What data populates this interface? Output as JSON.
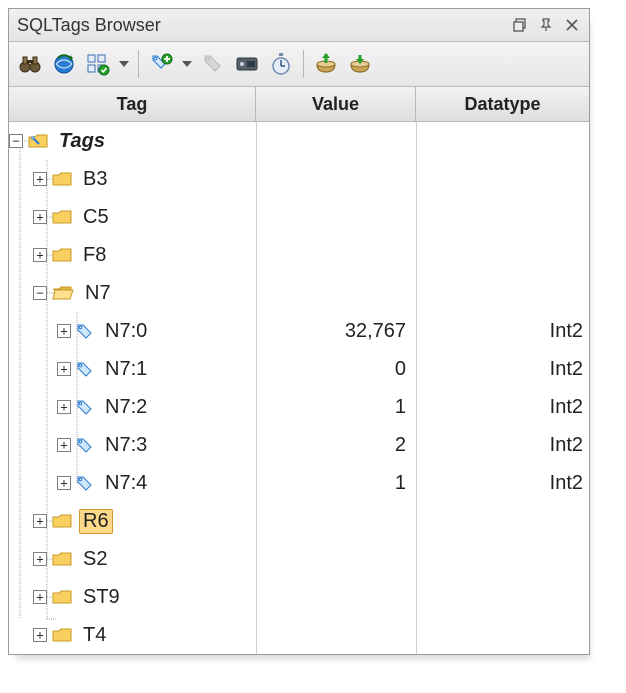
{
  "title": "SQLTags Browser",
  "toolbar": {
    "binoculars": "find-icon",
    "refresh": "refresh-icon",
    "multiselect": "multi-edit-icon",
    "newitem": "new-tag-icon",
    "writevalue": "write-value-icon",
    "device": "device-icon",
    "timer": "timer-icon",
    "import": "import-icon",
    "export": "export-icon"
  },
  "columns": {
    "c0": "Tag",
    "c1": "Value",
    "c2": "Datatype"
  },
  "root": {
    "label": "Tags"
  },
  "folders": {
    "b3": {
      "label": "B3"
    },
    "c5": {
      "label": "C5"
    },
    "f8": {
      "label": "F8"
    },
    "n7": {
      "label": "N7"
    },
    "r6": {
      "label": "R6"
    },
    "s2": {
      "label": "S2"
    },
    "st9": {
      "label": "ST9"
    },
    "t4": {
      "label": "T4"
    }
  },
  "n7_items": [
    {
      "label": "N7:0",
      "value": "32,767",
      "type": "Int2"
    },
    {
      "label": "N7:1",
      "value": "0",
      "type": "Int2"
    },
    {
      "label": "N7:2",
      "value": "1",
      "type": "Int2"
    },
    {
      "label": "N7:3",
      "value": "2",
      "type": "Int2"
    },
    {
      "label": "N7:4",
      "value": "1",
      "type": "Int2"
    }
  ]
}
